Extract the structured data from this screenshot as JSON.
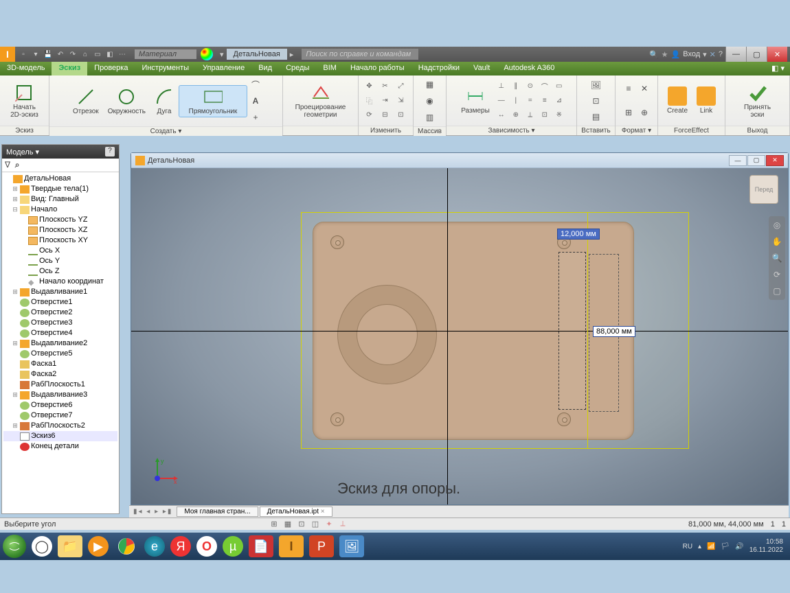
{
  "titlebar": {
    "material_placeholder": "Материал",
    "doc_tab": "ДетальНовая",
    "search_placeholder": "Поиск по справке и командам",
    "login": "Вход"
  },
  "tabs": {
    "t0": "3D-модель",
    "t1": "Эскиз",
    "t2": "Проверка",
    "t3": "Инструменты",
    "t4": "Управление",
    "t5": "Вид",
    "t6": "Среды",
    "t7": "BIM",
    "t8": "Начало работы",
    "t9": "Надстройки",
    "t10": "Vault",
    "t11": "Autodesk A360"
  },
  "ribbon": {
    "sketch_panel": "Эскиз",
    "start_sketch": "Начать\n2D-эскиз",
    "create_panel": "Создать ▾",
    "line": "Отрезок",
    "circle": "Окружность",
    "arc": "Дуга",
    "rect": "Прямоугольник",
    "project_panel": "",
    "project_geom": "Проецирование\nгеометрии",
    "modify_panel": "Изменить",
    "pattern_panel": "Массив",
    "dim_panel": "Зависимость ▾",
    "dimensions": "Размеры",
    "insert_panel": "Вставить",
    "format_panel": "Формат ▾",
    "forceeffect_panel": "ForceEffect",
    "create_btn": "Create",
    "link_btn": "Link",
    "exit_panel": "Выход",
    "finish": "Принять\nэски"
  },
  "model_panel": {
    "title": "Модель ▾",
    "root": "ДетальНовая",
    "solids": "Твердые тела(1)",
    "view": "Вид: Главный",
    "origin": "Начало",
    "plane_yz": "Плоскость YZ",
    "plane_xz": "Плоскость XZ",
    "plane_xy": "Плоскость XY",
    "axis_x": "Ось X",
    "axis_y": "Ось Y",
    "axis_z": "Ось Z",
    "origin_pt": "Начало координат",
    "extrude1": "Выдавливание1",
    "hole1": "Отверстие1",
    "hole2": "Отверстие2",
    "hole3": "Отверстие3",
    "hole4": "Отверстие4",
    "extrude2": "Выдавливание2",
    "hole5": "Отверстие5",
    "chamfer1": "Фаска1",
    "chamfer2": "Фаска2",
    "workplane1": "РабПлоскость1",
    "extrude3": "Выдавливание3",
    "hole6": "Отверстие6",
    "hole7": "Отверстие7",
    "workplane2": "РабПлоскость2",
    "sketch6": "Эскиз6",
    "endpart": "Конец детали"
  },
  "doc": {
    "title": "ДетальНовая",
    "viewcube": "Перед",
    "dim_top": "12,000 мм",
    "dim_right": "88,000 мм",
    "caption": "Эскиз для опоры."
  },
  "doctabs": {
    "home": "Моя главная стран...",
    "part": "ДетальНовая.ipt"
  },
  "status": {
    "prompt": "Выберите угол",
    "coords": "81,000 мм, 44,000 мм",
    "n1": "1",
    "n2": "1"
  },
  "taskbar": {
    "lang": "RU",
    "time": "10:58",
    "date": "16.11.2022"
  }
}
